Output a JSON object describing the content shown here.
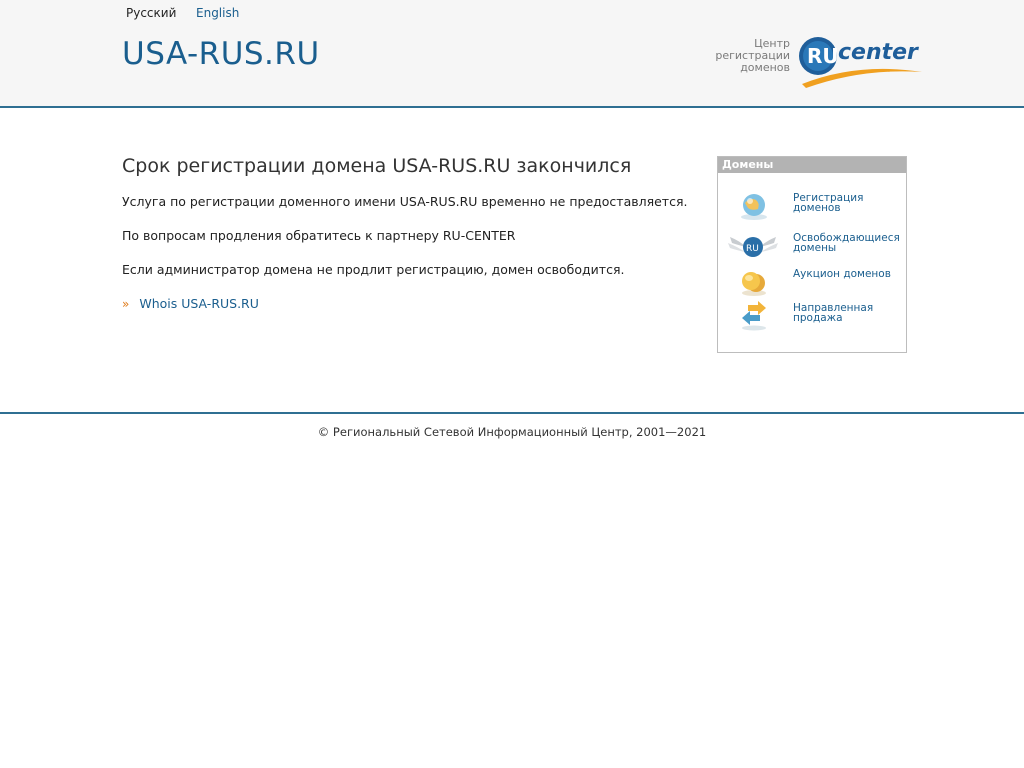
{
  "header": {
    "lang_ru": "Русский",
    "lang_en": "English",
    "site_title": "USA-RUS.RU",
    "rucenter_text_line1": "Центр",
    "rucenter_text_line2": "регистрации",
    "rucenter_text_line3": "доменов",
    "rucenter_logo_ru": "RU",
    "rucenter_logo_center": "center"
  },
  "main": {
    "title": "Срок регистрации домена USA-RUS.RU закончился",
    "paragraph1": "Услуга по регистрации доменного имени USA-RUS.RU временно не предоставляется.",
    "paragraph2": "По вопросам продления обратитесь к партнеру RU-CENTER",
    "paragraph3": "Если администратор домена не продлит регистрацию, домен освободится.",
    "whois_arrow": "»",
    "whois_link": "Whois USA-RUS.RU"
  },
  "sidebar": {
    "header": "Домены",
    "items": [
      {
        "line1": "Регистрация",
        "line2": "доменов",
        "icon": "globe-icon"
      },
      {
        "line1": "Освобождающиеся",
        "line2": "домены",
        "icon": "winged-ru-icon",
        "icon_text": "RU"
      },
      {
        "line1": "Аукцион доменов",
        "line2": "",
        "icon": "coins-icon"
      },
      {
        "line1": "Направленная",
        "line2": "продажа",
        "icon": "exchange-arrows-icon"
      }
    ]
  },
  "footer": {
    "copyright": "© Региональный Сетевой Информационный Центр, 2001—2021"
  },
  "colors": {
    "link": "#1a5e8e",
    "accent_line": "#2f6f92",
    "orange": "#e07b1a"
  }
}
